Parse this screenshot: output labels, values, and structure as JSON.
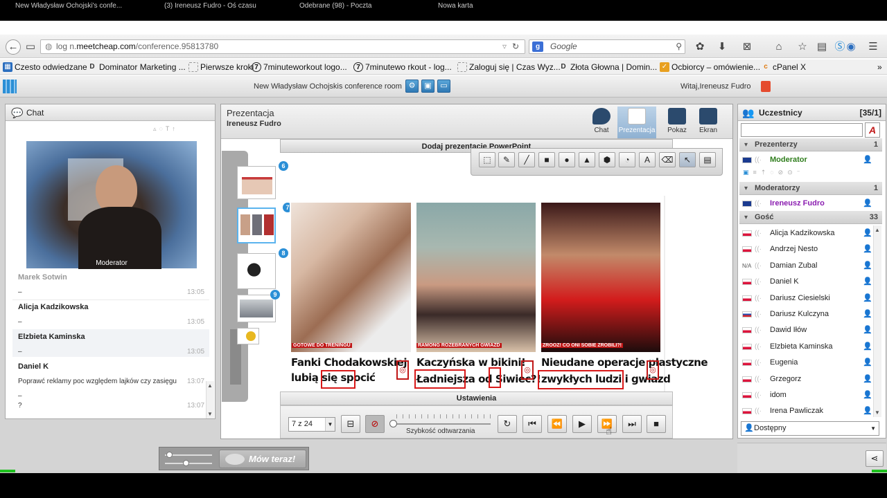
{
  "browser": {
    "tabs": [
      "New Władysław Ochojski's confe...",
      "(3) Ireneusz Fudro - Oś czasu",
      "Odebrane (98) - Poczta",
      "Nowa karta"
    ],
    "url_prefix": "log n.",
    "url_domain": "meetcheap.com",
    "url_suffix": "/conference.95813780",
    "search_placeholder": "Google",
    "bookmarks": [
      "Czesto odwiedzane",
      "Dominator Marketing ...",
      "Pierwsze kroki",
      "7minuteworkout logo...",
      "7minutewo rkout - log...",
      "Zaloguj się | Czas Wyz...",
      "Złota Głowna | Domin...",
      "Ocbiorcy – omówienie...",
      "cPanel X"
    ]
  },
  "app": {
    "room_title": "New Władysław Ochojskis conference room",
    "welcome": "Witaj,Ireneusz Fudro"
  },
  "chat": {
    "title": "Chat",
    "video_label": "Moderator",
    "messages": [
      {
        "name": "Marek Sotwin",
        "text": "",
        "time": "13:05"
      },
      {
        "name": "Alicja Kadzikowska",
        "text": "–",
        "time": "13:05"
      },
      {
        "name": "Elzbieta Kaminska",
        "text": "–",
        "time": "13:05"
      },
      {
        "name": "Daniel K",
        "text": "Poprawć reklamy poc względem lajków czy zasięgu",
        "time": "13:07"
      },
      {
        "name": "",
        "text": "–",
        "time": ""
      },
      {
        "name": "",
        "text": "?",
        "time": "13:07"
      }
    ]
  },
  "presentation": {
    "title": "Prezentacja",
    "presenter": "Ireneusz Fudro",
    "modes": [
      "Chat",
      "Prezentacja",
      "Pokaz",
      "Ekran"
    ],
    "add_ppt": "Dodaj prezentację PowerPoint",
    "thumb_numbers": [
      "6",
      "7",
      "8",
      "9"
    ],
    "slide": {
      "tags": [
        "GOTOWE DO TRENINGU",
        "RAMONG ROZEBRANYCH GWIAZD",
        "ZROOZ! CO ONI SOBIE ZROBILI?!"
      ],
      "titles": [
        [
          "Fanki Chodakowskiej",
          "lubią się spocić"
        ],
        [
          "Kaczyńska w bikini!",
          "Ładniejsza od Siwiec?!"
        ],
        [
          "Nieudane operacje plastyczne",
          "zwykłych ludzi i gwiazd"
        ]
      ]
    },
    "settings_label": "Ustawienia",
    "page_select": "7 z 24",
    "speed_label": "Szybkość odtwarzania",
    "talk_button": "Mów teraz!"
  },
  "participants": {
    "title": "Uczestnicy",
    "count": "[35/1]",
    "groups": [
      {
        "name": "Prezenterzy",
        "count": "1",
        "members": [
          "Moderator"
        ]
      },
      {
        "name": "Moderatorzy",
        "count": "1",
        "members": [
          "Ireneusz Fudro"
        ]
      },
      {
        "name": "Gość",
        "count": "33",
        "members": [
          "Alicja Kadzikowska",
          "Andrzej Nesto",
          "Damian Zubal",
          "Daniel K",
          "Dariusz Ciesielski",
          "Dariusz Kulczyna",
          "Dawid Iłów",
          "Elzbieta Kaminska",
          "Eugenia",
          "Grzegorz",
          "idom",
          "Irena Pawliczak"
        ]
      }
    ],
    "status": "Dostępny"
  },
  "colors": {
    "accent_blue": "#2b8fd6",
    "moderator_green": "#2f7d1c",
    "moderator_purple": "#8a1cb0",
    "headline_red": "#c01616"
  }
}
